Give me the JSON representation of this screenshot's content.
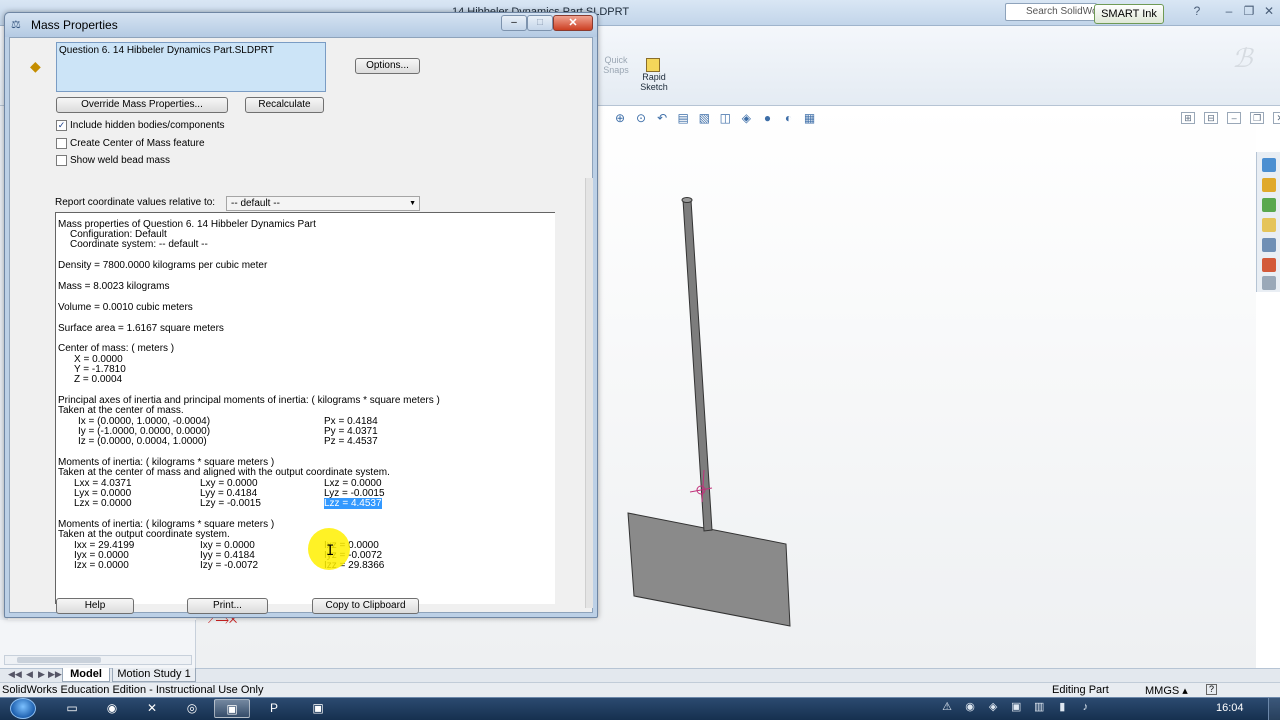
{
  "solidworks": {
    "title": "14 Hibbeler Dynamics Part.SLDPRT",
    "search_placeholder": "Search SolidWo",
    "smart_ink": "SMART Ink",
    "ribbon": {
      "quick_snaps": "Quick Snaps",
      "rapid_sketch": "Rapid Sketch"
    },
    "tabs": [
      "Model",
      "Motion Study 1"
    ],
    "status": {
      "left": "SolidWorks Education Edition - Instructional Use Only",
      "mode": "Editing Part",
      "units": "MMGS",
      "help_symbol": "?"
    }
  },
  "taskbar": {
    "clock": "16:04"
  },
  "dialog": {
    "title": "Mass Properties",
    "selected_item": "Question 6. 14 Hibbeler Dynamics Part.SLDPRT",
    "buttons": {
      "options": "Options...",
      "override": "Override Mass Properties...",
      "recalculate": "Recalculate",
      "help": "Help",
      "print": "Print...",
      "copy": "Copy to Clipboard"
    },
    "checkboxes": [
      {
        "label": "Include hidden bodies/components",
        "checked": true,
        "mark": "✓"
      },
      {
        "label": "Create Center of Mass feature",
        "checked": false,
        "mark": ""
      },
      {
        "label": "Show weld bead mass",
        "checked": false,
        "mark": ""
      }
    ],
    "coord_label": "Report coordinate values relative to:",
    "coord_value": "-- default --",
    "results": {
      "header": "Mass properties of Question 6. 14 Hibbeler Dynamics Part",
      "configuration": "Configuration: Default",
      "coord_system": "Coordinate system: -- default --",
      "density": "Density = 7800.0000 kilograms per cubic meter",
      "mass": "Mass = 8.0023 kilograms",
      "volume": "Volume = 0.0010 cubic meters",
      "surface_area": "Surface area = 1.6167 square meters",
      "com_title": "Center of mass: ( meters )",
      "com_x": "X = 0.0000",
      "com_y": "Y = -1.7810",
      "com_z": "Z = 0.0004",
      "principal_title": "Principal axes of inertia and principal moments of inertia: ( kilograms * square meters )",
      "principal_sub": "Taken at the center of mass.",
      "ix": "Ix = (0.0000, 1.0000, -0.0004)",
      "iy": "Iy = (-1.0000, 0.0000, 0.0000)",
      "iz": "Iz = (0.0000, 0.0004, 1.0000)",
      "px": "Px = 0.4184",
      "py": "Py = 4.0371",
      "pz": "Pz = 4.4537",
      "moi1_title": "Moments of inertia: ( kilograms * square meters )",
      "moi1_sub": "Taken at the center of mass and aligned with the output coordinate system.",
      "lxx": "Lxx = 4.0371",
      "lxy": "Lxy = 0.0000",
      "lxz": "Lxz = 0.0000",
      "lyx": "Lyx = 0.0000",
      "lyy": "Lyy = 0.4184",
      "lyz": "Lyz = -0.0015",
      "lzx": "Lzx = 0.0000",
      "lzy": "Lzy = -0.0015",
      "lzz": "Lzz = 4.4537",
      "moi2_title": "Moments of inertia: ( kilograms * square meters )",
      "moi2_sub": "Taken at the output coordinate system.",
      "ixx": "Ixx = 29.4199",
      "ixy": "Ixy = 0.0000",
      "ixz": "Ixz = 0.0000",
      "iyx": "Iyx = 0.0000",
      "iyy": "Iyy = 0.4184",
      "iyz": "Iyz = -0.0072",
      "izx": "Izx = 0.0000",
      "izy": "Izy = -0.0072",
      "izz": "Izz = 29.8366"
    }
  },
  "colors": {
    "selection": "#3399ff",
    "dialog_frame": "#bcd0e6",
    "cursor_highlight": "#fff000",
    "model_gray": "#8a8a8a"
  }
}
